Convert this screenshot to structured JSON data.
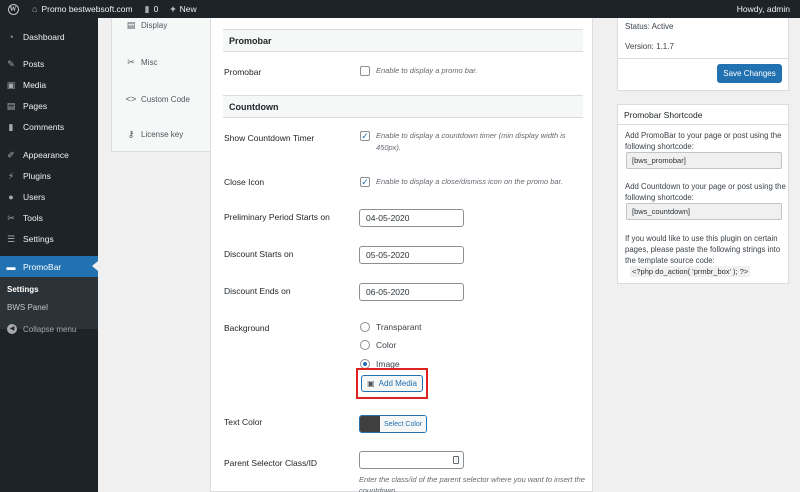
{
  "adminbar": {
    "site_name": "Promo bestwebsoft.com",
    "comments_count": "0",
    "new_label": "New",
    "howdy": "Howdy, admin"
  },
  "sidebar": {
    "items": [
      {
        "label": "Dashboard",
        "icon": "dashboard-icon"
      },
      {
        "label": "Posts",
        "icon": "pin-icon"
      },
      {
        "label": "Media",
        "icon": "media-icon"
      },
      {
        "label": "Pages",
        "icon": "page-icon"
      },
      {
        "label": "Comments",
        "icon": "comment-icon"
      },
      {
        "label": "Appearance",
        "icon": "brush-icon"
      },
      {
        "label": "Plugins",
        "icon": "plug-icon"
      },
      {
        "label": "Users",
        "icon": "user-icon"
      },
      {
        "label": "Tools",
        "icon": "wrench-icon"
      },
      {
        "label": "Settings",
        "icon": "sliders-icon"
      }
    ],
    "active": {
      "label": "PromoBar",
      "icon": "promobar-icon"
    },
    "submenu": [
      "Settings",
      "BWS Panel"
    ],
    "collapse": "Collapse menu"
  },
  "tabs": [
    "Display",
    "Misc",
    "Custom Code",
    "License key"
  ],
  "main": {
    "promobar_section": "Promobar",
    "promobar_label": "Promobar",
    "promobar_check": "Enable to display a promo bar.",
    "countdown_section": "Countdown",
    "show_timer_label": "Show Countdown Timer",
    "show_timer_check": "Enable to display a countdown timer (min display width is 450px).",
    "close_icon_label": "Close Icon",
    "close_icon_check": "Enable to display a close/dismiss icon on the promo bar.",
    "preliminary_label": "Preliminary Period Starts on",
    "preliminary_value": "04-05-2020",
    "discount_starts_label": "Discount Starts on",
    "discount_starts_value": "05-05-2020",
    "discount_ends_label": "Discount Ends on",
    "discount_ends_value": "06-05-2020",
    "background_label": "Background",
    "background_options": [
      "Transparant",
      "Color",
      "Image"
    ],
    "add_media": "Add Media",
    "text_color_label": "Text Color",
    "select_color": "Select Color",
    "text_color_value": "#3f3f3f",
    "parent_selector_label": "Parent Selector Class/ID",
    "parent_selector_help": "Enter the class/id of the parent selector where you want to insert the countdown."
  },
  "right": {
    "status": "Status: Active",
    "version": "Version: 1.1.7",
    "save": "Save Changes",
    "shortcode_title": "Promobar Shortcode",
    "promobar_text": "Add PromoBar to your page or post using the following shortcode:",
    "promobar_code": "[bws_promobar]",
    "countdown_text": "Add Countdown to your page or post using the following shortcode:",
    "countdown_code": "[bws_countdown]",
    "template_text": "If you would like to use this plugin on certain pages, please paste the following strings into the template source code:",
    "template_code": "<?php do_action( 'prmbr_box' ); ?>"
  },
  "colors": {
    "accent": "#2271b1",
    "sidebar_bg": "#1d2327",
    "highlight_border": "#e02222"
  }
}
